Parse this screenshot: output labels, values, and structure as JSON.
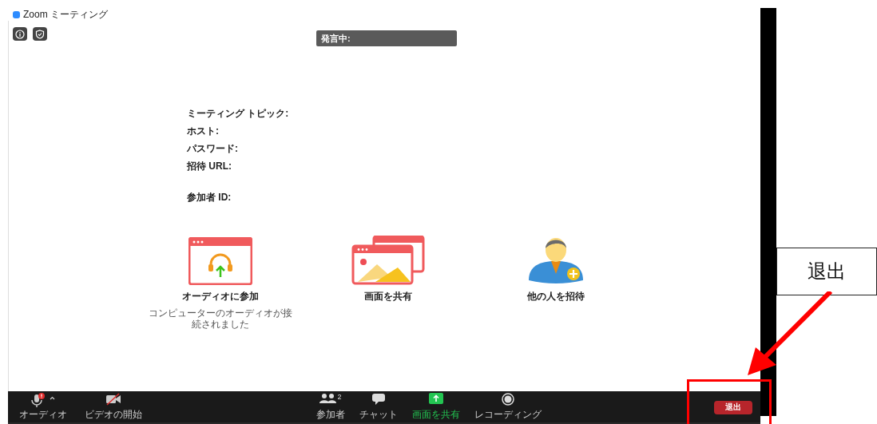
{
  "window": {
    "title": "Zoom ミーティング"
  },
  "speaker_label": "発言中:",
  "meeting_info": [
    [
      "ミーティング トピック:",
      "ホスト:",
      "パスワード:",
      "招待 URL:"
    ],
    [
      "参加者 ID:"
    ]
  ],
  "actions": [
    {
      "kind": "audio",
      "label": "オーディオに参加",
      "note": "コンピューターのオーディオが接続されました"
    },
    {
      "kind": "share",
      "label": "画面を共有"
    },
    {
      "kind": "invite",
      "label": "他の人を招待"
    }
  ],
  "toolbar_left": [
    {
      "kind": "audio",
      "label": "オーディオ",
      "highlighted": false
    },
    {
      "kind": "video",
      "label": "ビデオの開始",
      "highlighted": false
    }
  ],
  "toolbar_center": [
    {
      "kind": "participants",
      "label": "参加者",
      "count": "2",
      "highlighted": false
    },
    {
      "kind": "chat",
      "label": "チャット",
      "highlighted": false
    },
    {
      "kind": "share",
      "label": "画面を共有",
      "highlighted": true
    },
    {
      "kind": "record",
      "label": "レコーディング",
      "highlighted": false
    }
  ],
  "leave_button": "退出",
  "annotation": {
    "callout": "退出"
  }
}
